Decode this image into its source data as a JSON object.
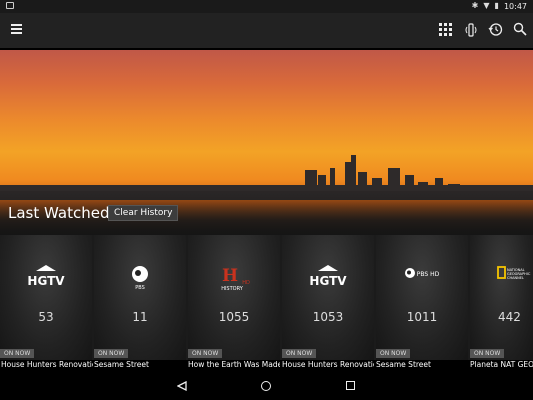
{
  "status_bar": {
    "time": "10:47"
  },
  "app_bar": {
    "menu_icon": "menu-icon",
    "icons": [
      "grid-icon",
      "remote-icon",
      "history-icon",
      "search-icon"
    ]
  },
  "hero": {
    "title": "Last Watched",
    "clear_history_label": "Clear History"
  },
  "channels": [
    {
      "network": "HGTV",
      "number": "53",
      "on_now": "ON NOW",
      "show": "House Hunters Renovation"
    },
    {
      "network": "PBS",
      "number": "11",
      "on_now": "ON NOW",
      "show": "Sesame Street"
    },
    {
      "network": "HISTORY",
      "number": "1055",
      "on_now": "ON NOW",
      "show": "How the Earth Was Made"
    },
    {
      "network": "HGTV",
      "number": "1053",
      "on_now": "ON NOW",
      "show": "House Hunters Renovation"
    },
    {
      "network": "PBS HD",
      "number": "1011",
      "on_now": "ON NOW",
      "show": "Sesame Street"
    },
    {
      "network": "NATIONAL GEOGRAPHIC CHANNEL",
      "number": "442",
      "on_now": "ON NOW",
      "show": "Planeta NAT GEO"
    }
  ],
  "colors": {
    "app_bar": "#222222",
    "card_bg": "#1b1b1b",
    "natgeo_yellow": "#f5c400",
    "history_red": "#c8321e"
  }
}
